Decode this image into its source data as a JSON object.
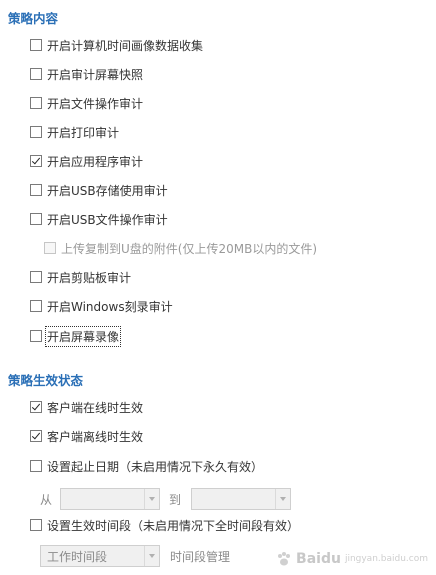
{
  "policy_content": {
    "title": "策略内容",
    "items": [
      {
        "label": "开启计算机时间画像数据收集",
        "checked": false
      },
      {
        "label": "开启审计屏幕快照",
        "checked": false
      },
      {
        "label": "开启文件操作审计",
        "checked": false
      },
      {
        "label": "开启打印审计",
        "checked": false
      },
      {
        "label": "开启应用程序审计",
        "checked": true
      },
      {
        "label": "开启USB存储使用审计",
        "checked": false
      },
      {
        "label": "开启USB文件操作审计",
        "checked": false
      },
      {
        "label": "上传复制到U盘的附件(仅上传20MB以内的文件)",
        "checked": false,
        "disabled": true
      },
      {
        "label": "开启剪贴板审计",
        "checked": false
      },
      {
        "label": "开启Windows刻录审计",
        "checked": false
      },
      {
        "label": "开启屏幕录像",
        "checked": false
      }
    ]
  },
  "effective_status": {
    "title": "策略生效状态",
    "items": [
      {
        "label": "客户端在线时生效",
        "checked": true
      },
      {
        "label": "客户端离线时生效",
        "checked": true
      },
      {
        "label": "设置起止日期（未启用情况下永久有效）",
        "checked": false
      },
      {
        "label": "设置生效时间段（未启用情况下全时间段有效）",
        "checked": false
      }
    ],
    "date_range": {
      "from_label": "从",
      "to_label": "到",
      "from_value": "",
      "to_value": ""
    },
    "time_period": {
      "selected": "工作时间段",
      "manage_label": "时间段管理"
    }
  },
  "watermark": {
    "brand": "Baidu",
    "sub": "jingyan.baidu.com"
  }
}
